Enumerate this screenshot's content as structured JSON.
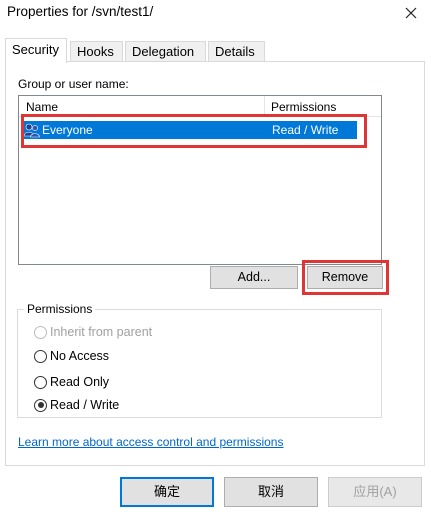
{
  "window": {
    "title": "Properties for /svn/test1/",
    "close_icon": "close-icon"
  },
  "tabs": [
    {
      "label": "Security",
      "active": true
    },
    {
      "label": "Hooks",
      "active": false
    },
    {
      "label": "Delegation",
      "active": false
    },
    {
      "label": "Details",
      "active": false
    }
  ],
  "security": {
    "group_label": "Group or user name:",
    "columns": {
      "name": "Name",
      "permissions": "Permissions"
    },
    "rows": [
      {
        "name": "Everyone",
        "permissions": "Read / Write",
        "icon": "users-group-icon",
        "selected": true
      }
    ],
    "add_button": "Add...",
    "remove_button": "Remove",
    "permissions_group": {
      "legend": "Permissions",
      "options": [
        {
          "label": "Inherit from parent",
          "checked": false,
          "disabled": true
        },
        {
          "label": "No Access",
          "checked": false,
          "disabled": false
        },
        {
          "label": "Read Only",
          "checked": false,
          "disabled": false
        },
        {
          "label": "Read / Write",
          "checked": true,
          "disabled": false
        }
      ]
    },
    "learn_more_link": "Learn more about access control and permissions"
  },
  "footer": {
    "ok": "确定",
    "cancel": "取消",
    "apply": "应用(A)"
  },
  "colors": {
    "selection": "#0078d7",
    "highlight_annotation": "#e03535",
    "link": "#0066cc"
  }
}
